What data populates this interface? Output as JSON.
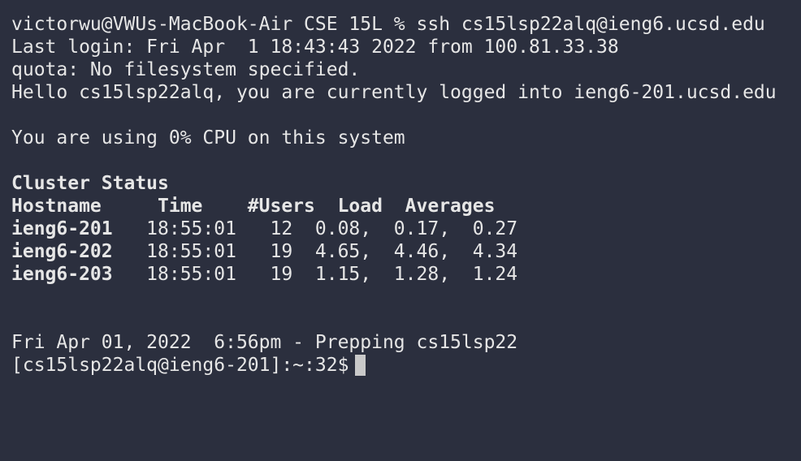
{
  "terminal": {
    "ssh_command_line": "victorwu@VWUs-MacBook-Air CSE 15L % ssh cs15lsp22alq@ieng6.ucsd.edu",
    "last_login_line": "Last login: Fri Apr  1 18:43:43 2022 from 100.81.33.38",
    "quota_line": "quota: No filesystem specified.",
    "hello_line": "Hello cs15lsp22alq, you are currently logged into ieng6-201.ucsd.edu",
    "cpu_line": "You are using 0% CPU on this system",
    "cluster_title": "Cluster Status",
    "cluster_header": "Hostname     Time    #Users  Load  Averages",
    "cluster_rows": [
      {
        "host": "ieng6-201",
        "rest": "   18:55:01   12  0.08,  0.17,  0.27"
      },
      {
        "host": "ieng6-202",
        "rest": "   18:55:01   19  4.65,  4.46,  4.34"
      },
      {
        "host": "ieng6-203",
        "rest": "   18:55:01   19  1.15,  1.28,  1.24"
      }
    ],
    "date_line": "Fri Apr 01, 2022  6:56pm - Prepping cs15lsp22",
    "prompt": "[cs15lsp22alq@ieng6-201]:~:32$"
  }
}
